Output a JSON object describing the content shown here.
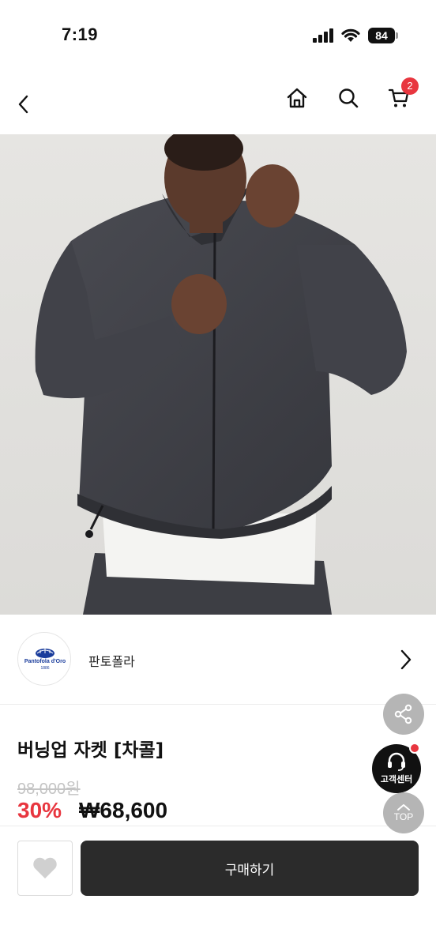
{
  "status_bar": {
    "time": "7:19",
    "battery": "84"
  },
  "nav": {
    "cart_count": "2",
    "icons": [
      "chevron-left-icon",
      "home-icon",
      "search-icon",
      "cart-icon"
    ]
  },
  "brand": {
    "name": "판토폴라",
    "logo_text": "Pantofola d'Oro",
    "logo_year": "1886"
  },
  "product": {
    "title": "버닝업 자켓 [차콜]",
    "original_price": "98,000원",
    "discount": "30%",
    "sale_price": "₩68,600"
  },
  "floating": {
    "cs_label": "고객센터",
    "top_label": "TOP"
  },
  "bottom_bar": {
    "buy_label": "구매하기"
  },
  "colors": {
    "accent": "#e8363f",
    "buy_button": "#2b2b2b",
    "floating_gray": "#b5b5b5"
  }
}
